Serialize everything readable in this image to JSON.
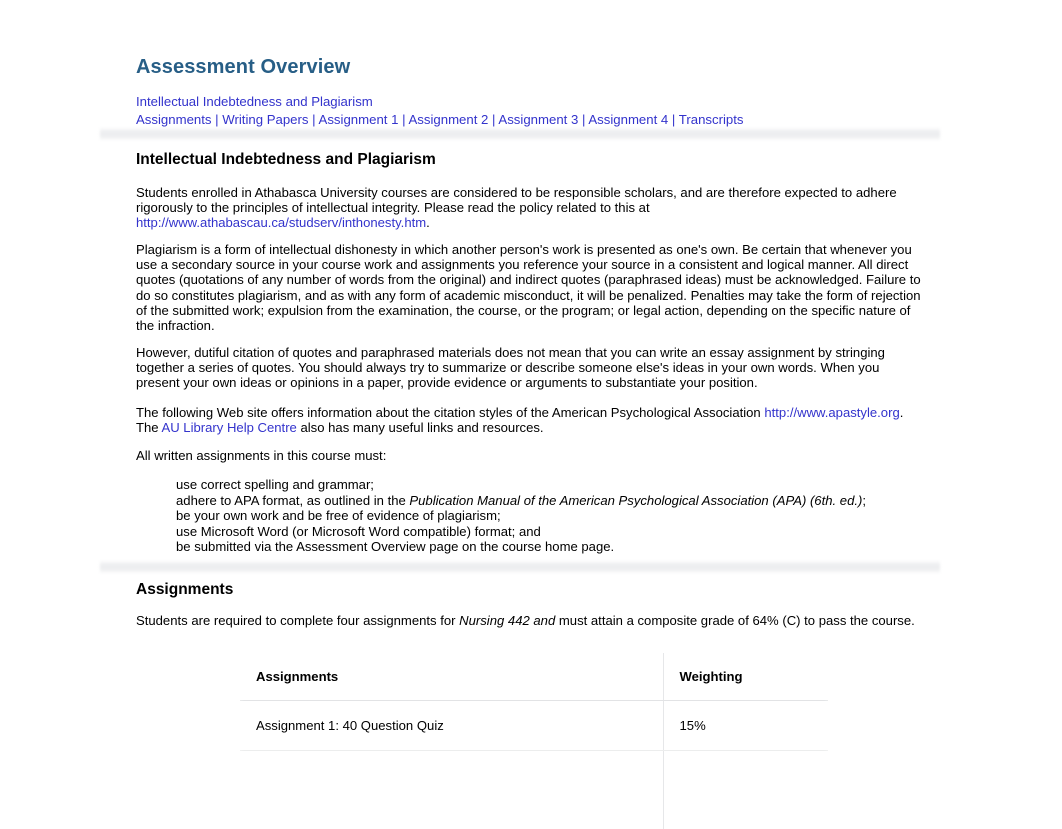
{
  "document": {
    "title": "Assessment Overview",
    "title_color": "#275e86",
    "link_color": "#3333cc"
  },
  "nav": {
    "line1": [
      {
        "label": "Intellectual Indebtedness and Plagiarism"
      }
    ],
    "line2": [
      {
        "label": "Assignments"
      },
      {
        "label": "Writing Papers"
      },
      {
        "label": "Assignment 1"
      },
      {
        "label": "Assignment 2"
      },
      {
        "label": "Assignment 3"
      },
      {
        "label": "Assignment 4"
      },
      {
        "label": "Transcripts"
      }
    ],
    "separator": "|"
  },
  "sections": {
    "plagiarism": {
      "heading": "Intellectual Indebtedness and Plagiarism",
      "p1_before": "Students enrolled in Athabasca University courses are considered to be responsible scholars, and are therefore expected to adhere rigorously to the principles of intellectual integrity. Please read the policy related to this at ",
      "p1_link": "http://www.athabascau.ca/studserv/inthonesty.htm",
      "p1_after": ".",
      "p2": "Plagiarism is a form of intellectual dishonesty in which another person's work is presented as one's own. Be certain that whenever you use a secondary source in your course work and assignments you reference your source in a consistent and logical manner. All direct quotes (quotations of any number of words from the original) and indirect quotes (paraphrased ideas) must be acknowledged. Failure to do so constitutes plagiarism, and as with any form of academic misconduct, it will be penalized. Penalties may take the form of rejection of the submitted work; expulsion from the examination, the course, or the program; or legal action, depending on the specific nature of the infraction.",
      "p3": "However, dutiful citation of quotes and paraphrased materials does not mean that you can write an essay assignment by stringing together a series of quotes. You should always try to summarize or describe someone else's ideas in your own words. When you present your own ideas or opinions in a paper, provide evidence or arguments to substantiate your position.",
      "p4_before": "The following Web site offers information about the citation styles of the American Psychological Association ",
      "p4_link1": "http://www.apastyle.org",
      "p4_mid": ". The ",
      "p4_link2": "AU Library Help Centre",
      "p4_after": " also has many useful links and resources.",
      "p5": "All written assignments in this course must:",
      "bullets": [
        {
          "text": "use correct spelling and grammar;",
          "italic": "",
          "tail": ""
        },
        {
          "text": "adhere to APA format, as outlined in the ",
          "italic": "Publication Manual of the American Psychological Association (APA) (6th. ed.)",
          "tail": ";"
        },
        {
          "text": "be your own work and be free of evidence of plagiarism;",
          "italic": "",
          "tail": ""
        },
        {
          "text": "use Microsoft Word (or Microsoft Word compatible) format; and",
          "italic": "",
          "tail": ""
        },
        {
          "text": "be submitted via the Assessment Overview page on the course home page.",
          "italic": "",
          "tail": ""
        }
      ]
    },
    "assignments": {
      "heading": "Assignments",
      "intro_before": "Students are required to complete four assignments for ",
      "intro_italic": "Nursing 442 and",
      "intro_after": " must attain a composite grade of 64% (C) to pass the course.",
      "table": {
        "headers": [
          "Assignments",
          "Weighting"
        ],
        "rows": [
          [
            "Assignment 1: 40 Question Quiz",
            "15%"
          ]
        ]
      }
    }
  }
}
